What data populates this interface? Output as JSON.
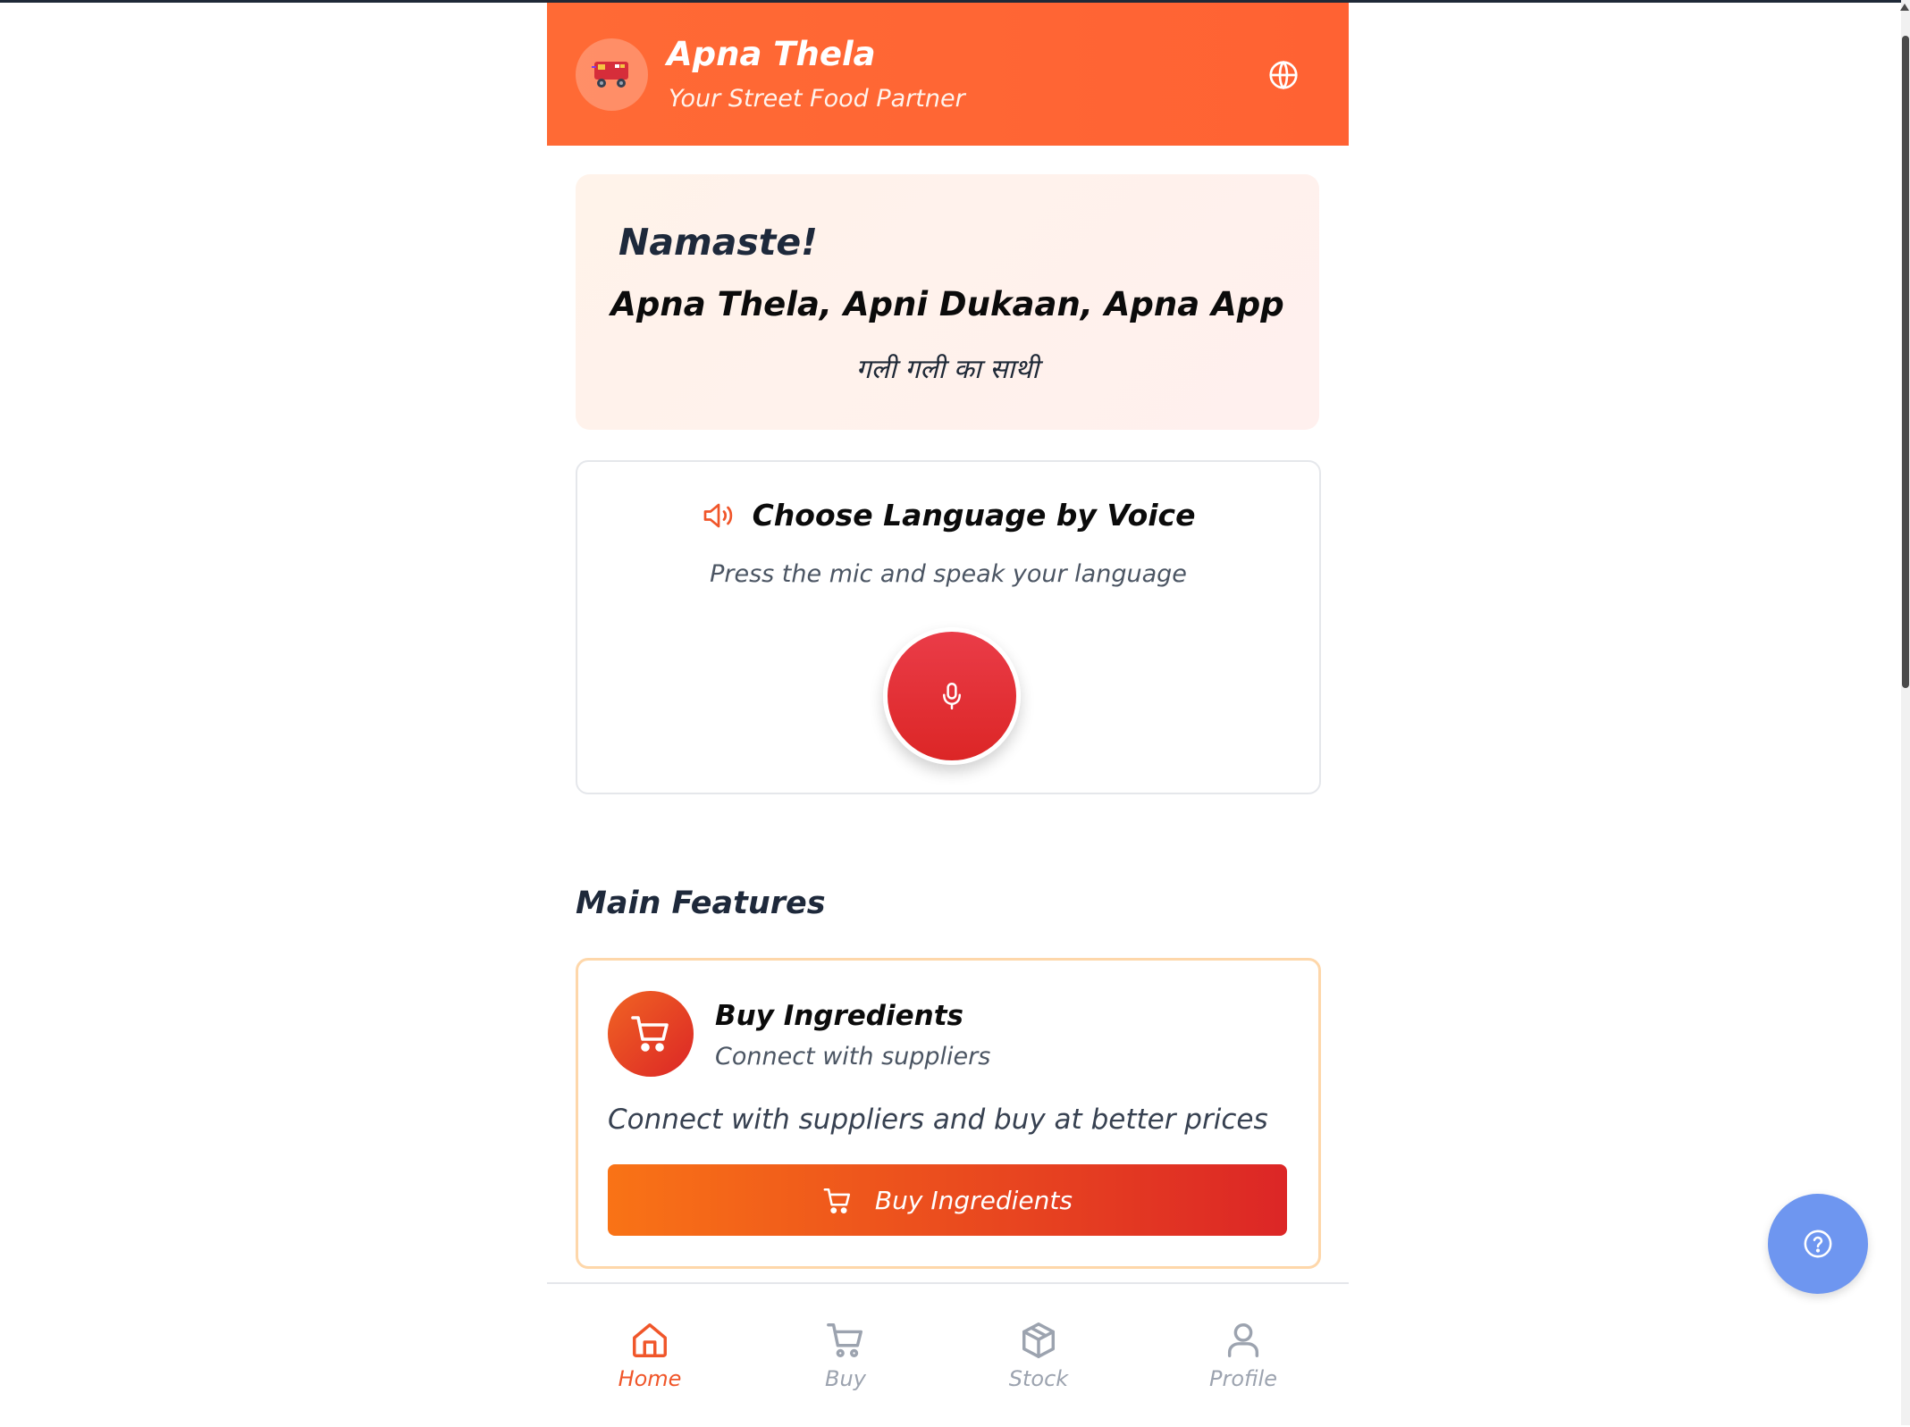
{
  "header": {
    "title": "Apna Thela",
    "subtitle": "Your Street Food Partner",
    "logo_icon": "food-cart-icon",
    "language_icon": "globe-icon"
  },
  "welcome": {
    "greeting": "Namaste!",
    "tagline": "Apna Thela, Apni Dukaan, Apna App",
    "hindi_tagline": "गली गली का साथी"
  },
  "voice": {
    "title": "Choose Language by Voice",
    "subtitle": "Press the mic and speak your language",
    "title_icon": "speaker-icon",
    "button_icon": "mic-icon"
  },
  "features": {
    "section_title": "Main Features",
    "items": [
      {
        "title": "Buy Ingredients",
        "subtitle": "Connect with suppliers",
        "description": "Connect with suppliers and buy at better prices",
        "button_label": "Buy Ingredients",
        "icon": "cart-icon"
      }
    ]
  },
  "nav": {
    "items": [
      {
        "label": "Home",
        "icon": "home-icon",
        "active": true
      },
      {
        "label": "Buy",
        "icon": "cart-icon",
        "active": false
      },
      {
        "label": "Stock",
        "icon": "box-icon",
        "active": false
      },
      {
        "label": "Profile",
        "icon": "user-icon",
        "active": false
      }
    ]
  },
  "help": {
    "icon": "help-icon"
  },
  "colors": {
    "brand": "#ff6633",
    "mic": "#dc2626",
    "active_nav": "#f0562a",
    "inactive_nav": "#9ca3af",
    "help_fab": "#6e96f0"
  }
}
